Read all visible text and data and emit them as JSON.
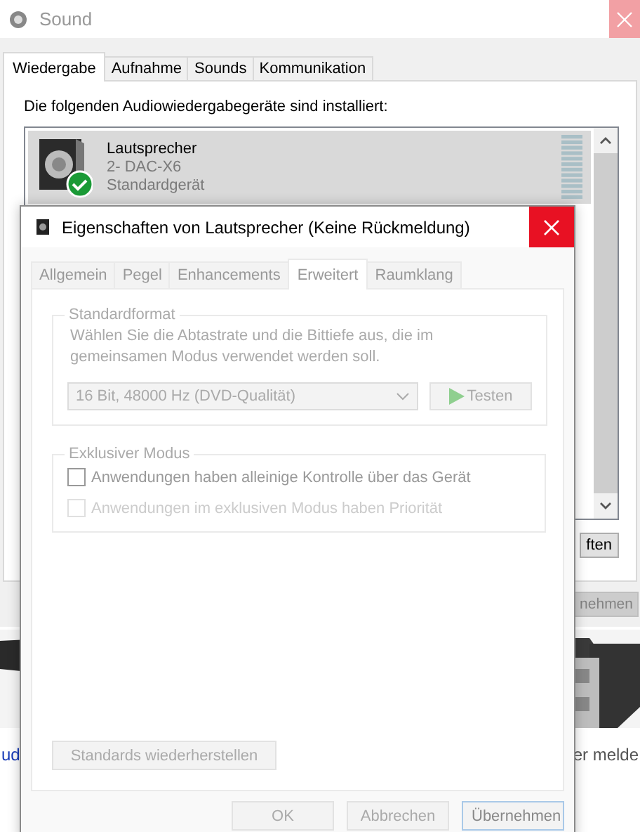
{
  "background_page": {
    "link_text": "ud",
    "text": "er melde"
  },
  "sound_window": {
    "title": "Sound",
    "tabs": [
      {
        "label": "Wiedergabe",
        "selected": true
      },
      {
        "label": "Aufnahme",
        "selected": false
      },
      {
        "label": "Sounds",
        "selected": false
      },
      {
        "label": "Kommunikation",
        "selected": false
      }
    ],
    "instruction": "Die folgenden Audiowiedergabegeräte sind installiert:",
    "devices": [
      {
        "name": "Lautsprecher",
        "model": "2- DAC-X6",
        "status": "Standardgerät",
        "selected": true,
        "default": true
      }
    ],
    "properties_button": "ften",
    "apply_button": "nehmen"
  },
  "dialog": {
    "title": "Eigenschaften von Lautsprecher (Keine Rückmeldung)",
    "tabs": [
      {
        "label": "Allgemein",
        "selected": false
      },
      {
        "label": "Pegel",
        "selected": false
      },
      {
        "label": "Enhancements",
        "selected": false
      },
      {
        "label": "Erweitert",
        "selected": true
      },
      {
        "label": "Raumklang",
        "selected": false
      }
    ],
    "format_group": {
      "title": "Standardformat",
      "description": "Wählen Sie die Abtastrate und die Bittiefe aus, die im gemeinsamen Modus verwendet werden soll.",
      "format": "16 Bit, 48000 Hz (DVD-Qualität)",
      "test_button": "Testen"
    },
    "exclusive_group": {
      "title": "Exklusiver Modus",
      "options": [
        {
          "label": "Anwendungen haben alleinige Kontrolle über das Gerät",
          "checked": false,
          "disabled": false
        },
        {
          "label": "Anwendungen im exklusiven Modus haben Priorität",
          "checked": false,
          "disabled": true
        }
      ]
    },
    "restore_button": "Standards wiederherstellen",
    "buttons": [
      {
        "label": "OK",
        "default": false
      },
      {
        "label": "Abbrechen",
        "default": false
      },
      {
        "label": "Übernehmen",
        "default": true
      }
    ]
  }
}
